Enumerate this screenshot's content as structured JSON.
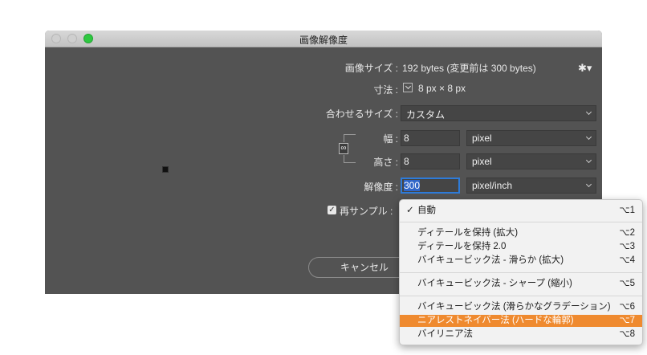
{
  "window": {
    "title": "画像解像度"
  },
  "image_size": {
    "label": "画像サイズ :",
    "value": "192 bytes (変更前は 300 bytes)"
  },
  "dimensions": {
    "label": "寸法 :",
    "value": "8 px × 8 px"
  },
  "fit_to": {
    "label": "合わせるサイズ :",
    "value": "カスタム"
  },
  "width": {
    "label": "幅 :",
    "value": "8",
    "unit": "pixel"
  },
  "height": {
    "label": "高さ :",
    "value": "8",
    "unit": "pixel"
  },
  "resolution": {
    "label": "解像度 :",
    "value": "300",
    "unit": "pixel/inch"
  },
  "resample": {
    "label": "再サンプル :",
    "checked": true
  },
  "buttons": {
    "cancel": "キャンセル"
  },
  "resample_menu": {
    "items": [
      {
        "label": "自動",
        "shortcut": "⌥1",
        "checked": true
      },
      {
        "label": "ディテールを保持 (拡大)",
        "shortcut": "⌥2"
      },
      {
        "label": "ディテールを保持 2.0",
        "shortcut": "⌥3"
      },
      {
        "label": "バイキュービック法 - 滑らか (拡大)",
        "shortcut": "⌥4"
      },
      {
        "label": "バイキュービック法 - シャープ (縮小)",
        "shortcut": "⌥5"
      },
      {
        "label": "バイキュービック法 (滑らかなグラデーション)",
        "shortcut": "⌥6"
      },
      {
        "label": "ニアレストネイバー法 (ハードな輪郭)",
        "shortcut": "⌥7",
        "highlighted": true
      },
      {
        "label": "バイリニア法",
        "shortcut": "⌥8"
      }
    ]
  },
  "colors": {
    "dialog_bg": "#535353",
    "highlight": "#ef8a2f",
    "focus": "#2e7bd8"
  }
}
